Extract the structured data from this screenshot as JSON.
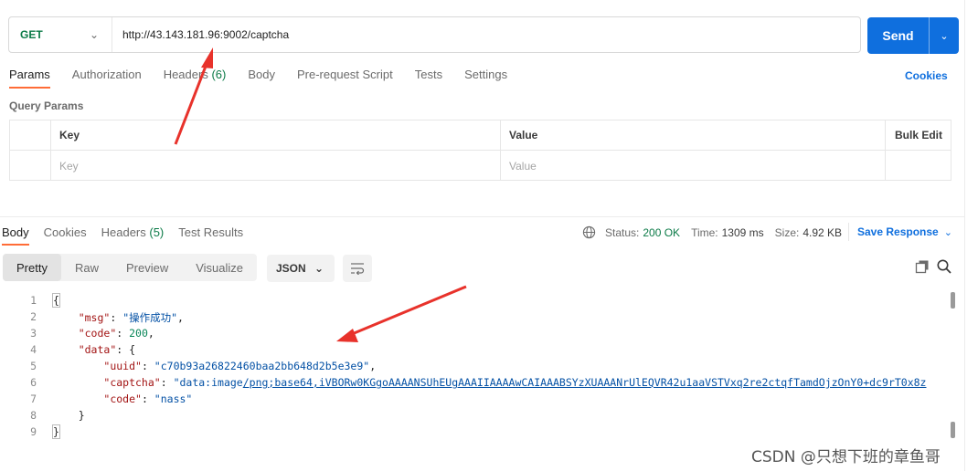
{
  "request": {
    "method": "GET",
    "url": "http://43.143.181.96:9002/captcha",
    "send_label": "Send"
  },
  "request_tabs": [
    {
      "label": "Params",
      "active": true
    },
    {
      "label": "Authorization"
    },
    {
      "label": "Headers",
      "count": "(6)"
    },
    {
      "label": "Body"
    },
    {
      "label": "Pre-request Script"
    },
    {
      "label": "Tests"
    },
    {
      "label": "Settings"
    }
  ],
  "cookies_label": "Cookies",
  "query_params": {
    "title": "Query Params",
    "headers": {
      "key": "Key",
      "value": "Value",
      "bulk": "Bulk Edit"
    },
    "placeholder": {
      "key": "Key",
      "value": "Value"
    }
  },
  "response_tabs": [
    {
      "label": "Body",
      "active": true
    },
    {
      "label": "Cookies"
    },
    {
      "label": "Headers",
      "count": "(5)"
    },
    {
      "label": "Test Results"
    }
  ],
  "status": {
    "status_label": "Status:",
    "status_value": "200 OK",
    "time_label": "Time:",
    "time_value": "1309 ms",
    "size_label": "Size:",
    "size_value": "4.92 KB"
  },
  "save_response_label": "Save Response",
  "format_tabs": [
    "Pretty",
    "Raw",
    "Preview",
    "Visualize"
  ],
  "format_type": "JSON",
  "code": {
    "line_numbers": [
      "1",
      "2",
      "3",
      "4",
      "5",
      "6",
      "7",
      "8",
      "9"
    ],
    "open_brace": "{",
    "close_brace": "}",
    "msg_key": "\"msg\"",
    "msg_value": "\"操作成功\"",
    "code_key": "\"code\"",
    "code_value": "200",
    "data_key": "\"data\"",
    "uuid_key": "\"uuid\"",
    "uuid_value": "\"c70b93a26822460baa2bb648d2b5e3e9\"",
    "captcha_key": "\"captcha\"",
    "captcha_prefix": "\"data:image",
    "captcha_link": "/png;base64,iVBORw0KGgoAAAANSUhEUgAAAIIAAAAwCAIAAABSYzXUAAANrUlEQVR42u1aaVSTVxq2re2ctqfTamdOjzOnY0+dc9rT0x8z",
    "inner_code_key": "\"code\"",
    "inner_code_value": "\"nass\""
  },
  "watermark": "CSDN @只想下班的章鱼哥",
  "colors": {
    "accent": "#ff6c37",
    "primary": "#0f6fde",
    "success": "#0b7a47",
    "annotation": "#e8322b"
  }
}
